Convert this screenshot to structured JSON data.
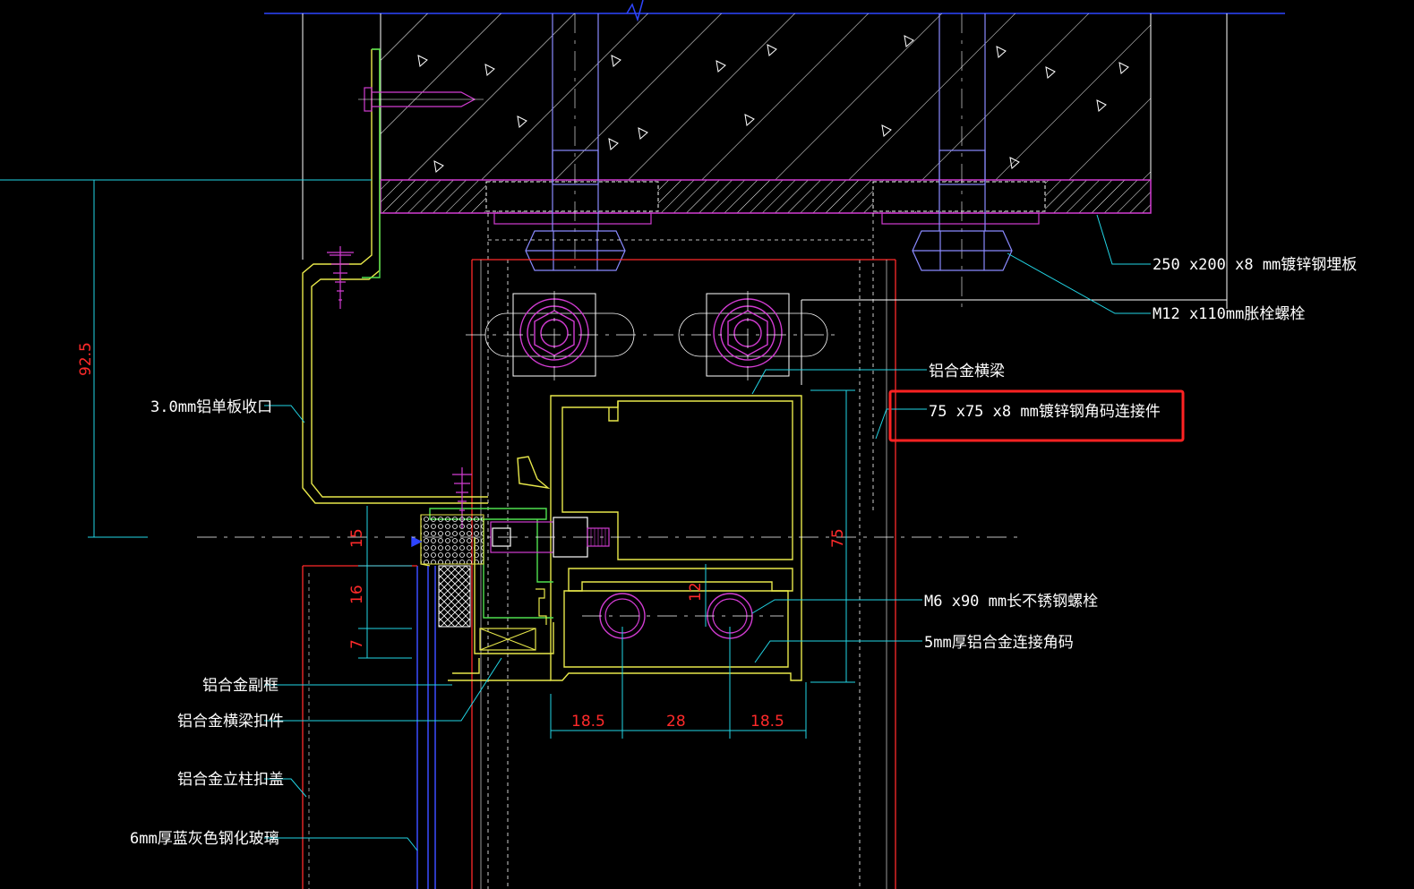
{
  "drawing": {
    "background": "#000000",
    "colors": {
      "structure": "#ffffff",
      "aluminum": "#e8e84a",
      "steel_plate": "#d23cd2",
      "leader": "#22d6e6",
      "dimension": "#ff2a2a",
      "glass": "#3a4cff",
      "angle": "#4fe04f",
      "highlight_box": "#ff2222"
    },
    "labels": {
      "embed_plate": "250 x200 x8 mm镀锌钢埋板",
      "anchor_bolt": "M12 x110mm胀栓螺栓",
      "transom": "铝合金横梁",
      "steel_angle": "75 x75 x8 mm镀锌钢角码连接件",
      "cover_flashing": "3.0mm铝单板收口",
      "ss_bolt": "M6 x90 mm长不锈钢螺栓",
      "alu_angle": "5mm厚铝合金连接角码",
      "sub_frame": "铝合金副框",
      "transom_cover": "铝合金横梁扣件",
      "mullion_cover": "铝合金立柱扣盖",
      "glass": "6mm厚蓝灰色钢化玻璃"
    },
    "dimensions": {
      "d_92_5": "92.5",
      "d_15": "15",
      "d_16": "16",
      "d_7": "7",
      "d_75": "75",
      "d_12": "12",
      "d_18_5_left": "18.5",
      "d_28": "28",
      "d_18_5_right": "18.5"
    },
    "highlighted_label": "steel_angle"
  }
}
